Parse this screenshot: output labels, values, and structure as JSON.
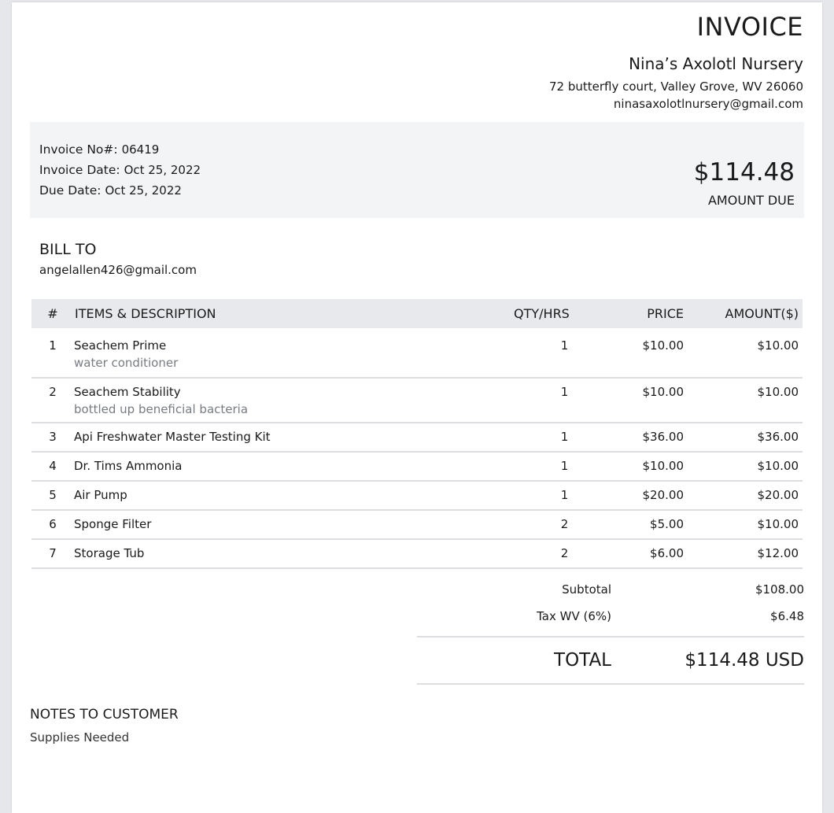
{
  "header": {
    "title": "INVOICE",
    "business_name": "Nina’s Axolotl Nursery",
    "address": "72 butterfly court, Valley Grove, WV 26060",
    "email": "ninasaxolotlnursery@gmail.com"
  },
  "summary": {
    "invoice_no_label": "Invoice No#:",
    "invoice_no": "06419",
    "invoice_date_label": "Invoice Date:",
    "invoice_date": "Oct 25, 2022",
    "due_date_label": "Due Date:",
    "due_date": "Oct 25, 2022",
    "amount_due": "$114.48",
    "amount_due_label": "AMOUNT DUE"
  },
  "bill_to": {
    "heading": "BILL TO",
    "email": "angelallen426@gmail.com"
  },
  "table": {
    "headers": {
      "num": "#",
      "desc": "ITEMS & DESCRIPTION",
      "qty": "QTY/HRS",
      "price": "PRICE",
      "amount": "AMOUNT($)"
    },
    "rows": [
      {
        "num": "1",
        "item": "Seachem Prime",
        "description": "water conditioner",
        "qty": "1",
        "price": "$10.00",
        "amount": "$10.00"
      },
      {
        "num": "2",
        "item": "Seachem Stability",
        "description": "bottled up beneficial bacteria",
        "qty": "1",
        "price": "$10.00",
        "amount": "$10.00"
      },
      {
        "num": "3",
        "item": "Api Freshwater Master Testing Kit",
        "description": "",
        "qty": "1",
        "price": "$36.00",
        "amount": "$36.00"
      },
      {
        "num": "4",
        "item": "Dr. Tims Ammonia",
        "description": "",
        "qty": "1",
        "price": "$10.00",
        "amount": "$10.00"
      },
      {
        "num": "5",
        "item": "Air Pump",
        "description": "",
        "qty": "1",
        "price": "$20.00",
        "amount": "$20.00"
      },
      {
        "num": "6",
        "item": "Sponge Filter",
        "description": "",
        "qty": "2",
        "price": "$5.00",
        "amount": "$10.00"
      },
      {
        "num": "7",
        "item": "Storage Tub",
        "description": "",
        "qty": "2",
        "price": "$6.00",
        "amount": "$12.00"
      }
    ]
  },
  "totals": {
    "subtotal_label": "Subtotal",
    "subtotal": "$108.00",
    "tax_label": "Tax WV (6%)",
    "tax": "$6.48",
    "total_label": "TOTAL",
    "total": "$114.48 USD"
  },
  "notes": {
    "heading": "NOTES TO CUSTOMER",
    "text": "Supplies Needed"
  }
}
